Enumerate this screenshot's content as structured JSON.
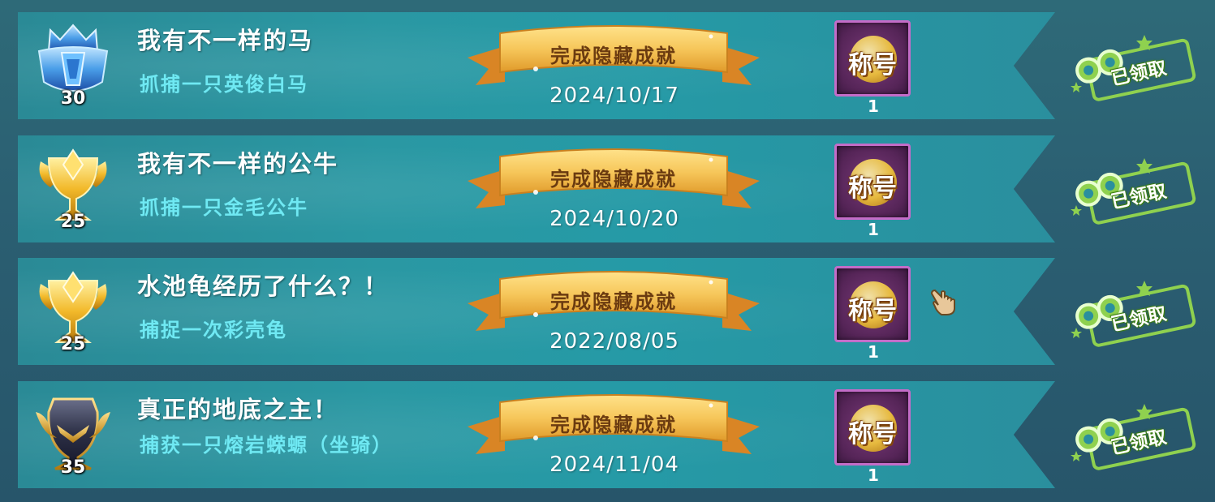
{
  "achievements": [
    {
      "badge_type": "crystal-crown",
      "badge_level": "30",
      "title": "我有不一样的马",
      "description": "抓捕一只英俊白马",
      "status_ribbon": "完成隐藏成就",
      "date": "2024/10/17",
      "reward_label": "称号",
      "reward_count": "1",
      "claimed_label": "已领取"
    },
    {
      "badge_type": "gold-trophy",
      "badge_level": "25",
      "title": "我有不一样的公牛",
      "description": "抓捕一只金毛公牛",
      "status_ribbon": "完成隐藏成就",
      "date": "2024/10/20",
      "reward_label": "称号",
      "reward_count": "1",
      "claimed_label": "已领取"
    },
    {
      "badge_type": "gold-trophy",
      "badge_level": "25",
      "title": "水池龟经历了什么？！",
      "description": "捕捉一次彩壳龟",
      "status_ribbon": "完成隐藏成就",
      "date": "2022/08/05",
      "reward_label": "称号",
      "reward_count": "1",
      "claimed_label": "已领取"
    },
    {
      "badge_type": "dark-gold-trophy",
      "badge_level": "35",
      "title": "真正的地底之主！",
      "description": "捕获一只熔岩蝾螈（坐骑）",
      "status_ribbon": "完成隐藏成就",
      "date": "2024/11/04",
      "reward_label": "称号",
      "reward_count": "1",
      "claimed_label": "已领取"
    }
  ],
  "colors": {
    "row_bg": "#2a98a3",
    "title_text": "#ffffff",
    "description_text": "#6fe9f3",
    "ribbon_gold": "#f6c65a",
    "ribbon_text": "#6b3b10",
    "reward_frame": "#c46cc8",
    "claimed_green": "#8fd14f"
  },
  "icons": [
    "crystal-crown-badge",
    "gold-trophy-badge",
    "dark-gold-trophy-badge",
    "ribbon-banner",
    "title-reward-icon",
    "claimed-stamp-icon",
    "hand-cursor-icon"
  ]
}
